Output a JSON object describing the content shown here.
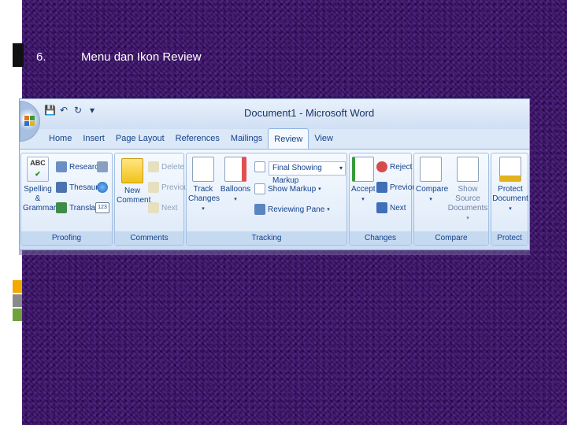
{
  "slide": {
    "number": "6.",
    "title": "Menu dan Ikon Review"
  },
  "accents": {
    "black": "#111111",
    "stack": [
      "#f2a900",
      "#8a8a8a",
      "#6fa23a"
    ]
  },
  "word": {
    "window_title": "Document1 - Microsoft Word",
    "qat": {
      "save": "💾",
      "undo": "↶",
      "redo": "↻",
      "more": "▾"
    },
    "tabs": [
      "Home",
      "Insert",
      "Page Layout",
      "References",
      "Mailings",
      "Review",
      "View"
    ],
    "active_tab": "Review",
    "groups": {
      "proofing": {
        "label": "Proofing",
        "spelling": "Spelling &",
        "grammar": "Grammar",
        "abc": "ABC",
        "research": "Research",
        "thesaurus": "Thesaurus",
        "translate": "Translate",
        "counter": "123"
      },
      "comments": {
        "label": "Comments",
        "new": "New",
        "comment": "Comment",
        "delete": "Delete",
        "previous": "Previous",
        "next": "Next"
      },
      "tracking": {
        "label": "Tracking",
        "track": "Track",
        "changes": "Changes",
        "balloons": "Balloons",
        "markup_select": "Final Showing Markup",
        "show_markup": "Show Markup",
        "reviewing_pane": "Reviewing Pane"
      },
      "changes": {
        "label": "Changes",
        "accept": "Accept",
        "reject": "Reject",
        "previous": "Previous",
        "next": "Next"
      },
      "compare": {
        "label": "Compare",
        "compare": "Compare",
        "show_source": "Show Source",
        "documents": "Documents"
      },
      "protect": {
        "label": "Protect",
        "protect": "Protect",
        "document": "Document"
      }
    }
  }
}
